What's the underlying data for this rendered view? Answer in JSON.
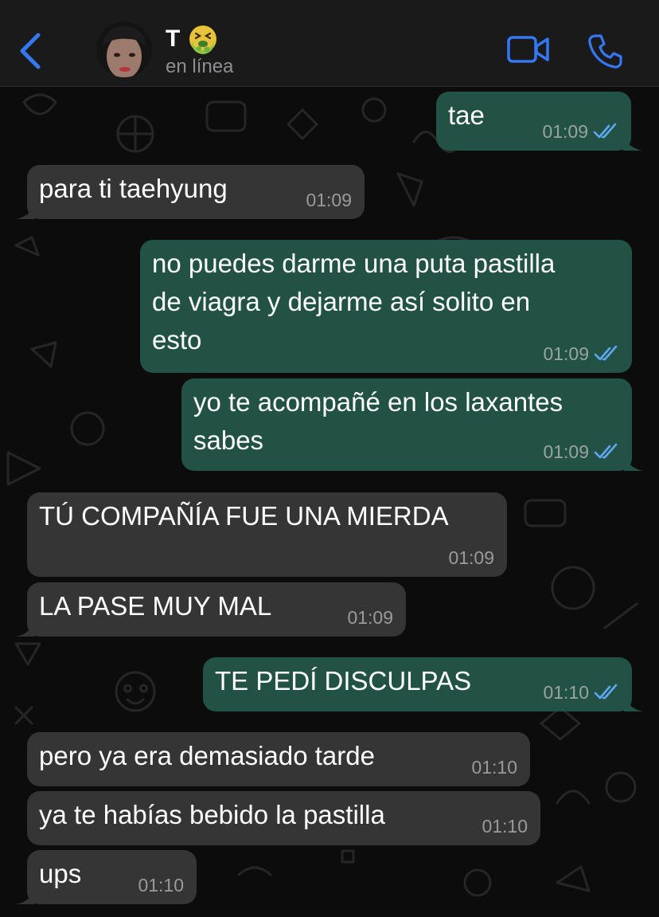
{
  "header": {
    "back_icon": "chevron-left-icon",
    "contact_name": "T",
    "contact_emoji_icon": "nauseated-face-emoji",
    "status": "en línea",
    "video_icon": "video-camera-icon",
    "call_icon": "phone-icon"
  },
  "colors": {
    "accent": "#3478f6",
    "outgoing_bubble": "#215245",
    "incoming_bubble": "#353535",
    "read_ticks": "#5fa8f5",
    "header_bg": "#1a1a1a"
  },
  "messages": [
    {
      "direction": "out",
      "text": "tae",
      "time": "01:09",
      "status": "read"
    },
    {
      "direction": "in",
      "text": "para ti taehyung",
      "time": "01:09"
    },
    {
      "direction": "out",
      "text": "no puedes darme una puta pastilla de viagra y dejarme así solito en esto",
      "lines": [
        "no puedes darme una puta pastilla",
        "de viagra y dejarme así solito en",
        "esto"
      ],
      "time": "01:09",
      "status": "read"
    },
    {
      "direction": "out",
      "text": "yo te acompañé en los laxantes sabes",
      "lines": [
        "yo te acompañé en los laxantes",
        "sabes"
      ],
      "time": "01:09",
      "status": "read"
    },
    {
      "direction": "in",
      "text": "TÚ COMPAÑÍA FUE UNA MIERDA",
      "time": "01:09"
    },
    {
      "direction": "in",
      "text": "LA PASE MUY MAL",
      "time": "01:09"
    },
    {
      "direction": "out",
      "text": "TE PEDÍ DISCULPAS",
      "time": "01:10",
      "status": "read"
    },
    {
      "direction": "in",
      "text": "pero ya era demasiado tarde",
      "time": "01:10"
    },
    {
      "direction": "in",
      "text": "ya te habías bebido la pastilla",
      "time": "01:10"
    },
    {
      "direction": "in",
      "text": "ups",
      "time": "01:10"
    }
  ]
}
